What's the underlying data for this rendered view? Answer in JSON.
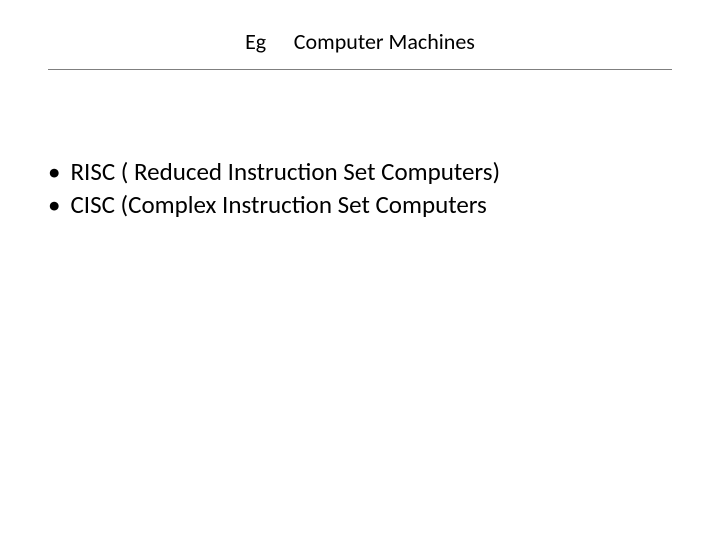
{
  "title": {
    "left": "Eg",
    "right": "Computer Machines"
  },
  "bullets": [
    "RISC ( Reduced Instruction Set Computers)",
    "CISC (Complex Instruction Set Computers"
  ]
}
